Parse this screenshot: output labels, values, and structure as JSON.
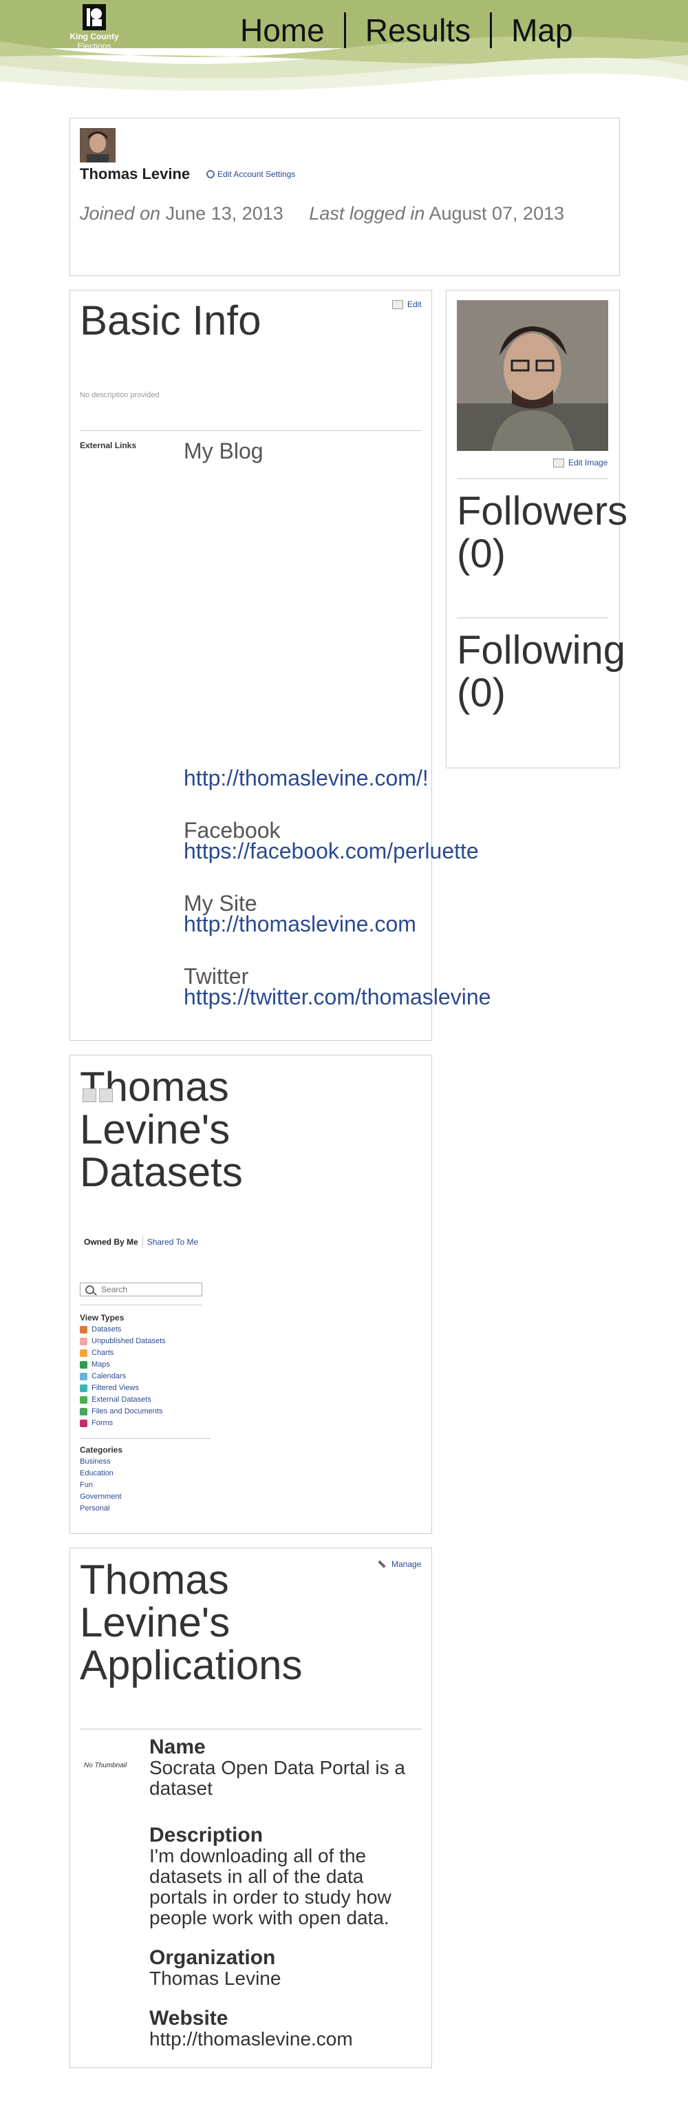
{
  "header": {
    "logo": {
      "line1": "King County",
      "line2": "Elections"
    },
    "nav": [
      {
        "label": "Home"
      },
      {
        "label": "Results"
      },
      {
        "label": "Map"
      }
    ]
  },
  "profile": {
    "name": "Thomas Levine",
    "edit_settings": "Edit Account Settings",
    "joined_label": "Joined on",
    "joined_date": "June 13, 2013",
    "logged_label": "Last logged in",
    "logged_date": "August 07, 2013"
  },
  "basic_info": {
    "title": "Basic Info",
    "edit": "Edit",
    "description": "No description provided",
    "external_links_label": "External Links",
    "links": [
      {
        "title": "My Blog",
        "url": "http://thomaslevine.com/!"
      },
      {
        "title": "Facebook",
        "url": "https://facebook.com/perluette"
      },
      {
        "title": "My Site",
        "url": "http://thomaslevine.com"
      },
      {
        "title": "Twitter",
        "url": "https://twitter.com/thomaslevine"
      }
    ]
  },
  "side": {
    "edit_image": "Edit Image",
    "followers_label": "Followers",
    "followers_count": "(0)",
    "following_label": "Following",
    "following_count": "(0)"
  },
  "datasets": {
    "title_lines": [
      "Thomas",
      "Levine's",
      "Datasets"
    ],
    "tabs": [
      {
        "label": "Owned By Me"
      },
      {
        "label": "Shared To Me"
      }
    ],
    "search_placeholder": "Search",
    "view_types_label": "View Types",
    "view_types": [
      {
        "label": "Datasets",
        "color": "#e07a3a"
      },
      {
        "label": "Unpublished Datasets",
        "color": "#f0a8a0"
      },
      {
        "label": "Charts",
        "color": "#f3a53c"
      },
      {
        "label": "Maps",
        "color": "#2e9b4f"
      },
      {
        "label": "Calendars",
        "color": "#6ab4d8"
      },
      {
        "label": "Filtered Views",
        "color": "#3bb3b0"
      },
      {
        "label": "External Datasets",
        "color": "#4caf50"
      },
      {
        "label": "Files and Documents",
        "color": "#4aa35a"
      },
      {
        "label": "Forms",
        "color": "#c0306a"
      }
    ],
    "categories_label": "Categories",
    "categories": [
      "Business",
      "Education",
      "Fun",
      "Government",
      "Personal"
    ]
  },
  "apps": {
    "title_lines": [
      "Thomas",
      "Levine's",
      "Applications"
    ],
    "manage": "Manage",
    "no_thumbnail": "No Thumbnail",
    "name_label": "Name",
    "name_value": "Socrata Open Data Portal is a dataset",
    "description_label": "Description",
    "description_value": "I'm downloading all of the datasets in all of the data portals in order to study how people work with open data.",
    "organization_label": "Organization",
    "organization_value": "Thomas Levine",
    "website_label": "Website",
    "website_value": "http://thomaslevine.com"
  },
  "colors": {
    "header_green": "#a9bb72",
    "link_blue": "#2b4a8f"
  }
}
